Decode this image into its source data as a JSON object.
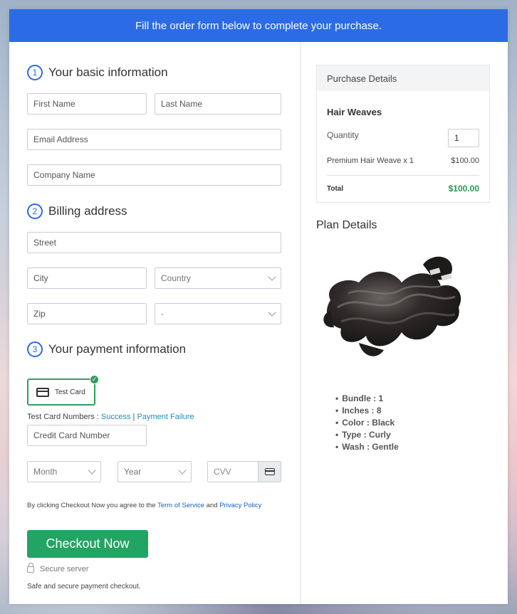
{
  "banner": {
    "text": "Fill the order form below to complete your purchase."
  },
  "basic_info": {
    "step": "1",
    "title": "Your basic information",
    "first_name_placeholder": "First Name",
    "last_name_placeholder": "Last Name",
    "email_placeholder": "Email Address",
    "company_placeholder": "Company Name"
  },
  "billing": {
    "step": "2",
    "title": "Billing address",
    "street_placeholder": "Street",
    "city_placeholder": "City",
    "country_select": "Country",
    "zip_placeholder": "Zip",
    "state_select": "-"
  },
  "payment": {
    "step": "3",
    "title": "Your payment information",
    "test_card_label": "Test Card",
    "test_numbers_label": "Test Card Numbers : ",
    "success_link": "Success",
    "separator": " | ",
    "failure_link": "Payment Failure",
    "card_number_placeholder": "Credit Card Number",
    "month_select": "Month",
    "year_select": "Year",
    "cvv_placeholder": "CVV"
  },
  "agreement": {
    "prefix": "By clicking Checkout Now you agree to the ",
    "terms_link": "Term of Service",
    "and": " and ",
    "privacy_link": "Privacy Policy"
  },
  "checkout_button": "Checkout Now",
  "secure_label": "Secure server",
  "safe_text": "Safe and secure payment checkout.",
  "purchase": {
    "header": "Purchase Details",
    "product": "Hair Weaves",
    "quantity_label": "Quantity",
    "quantity_value": "1",
    "line_item": "Premium Hair Weave x 1",
    "line_price": "$100.00",
    "total_label": "Total",
    "total_value": "$100.00"
  },
  "plan": {
    "title": "Plan Details",
    "features": [
      "Bundle : 1",
      "Inches : 8",
      "Color : Black",
      "Type : Curly",
      "Wash : Gentle"
    ]
  },
  "colors": {
    "accent": "#2b6be6",
    "success": "#22a463",
    "total_green": "#1f9e4f"
  }
}
